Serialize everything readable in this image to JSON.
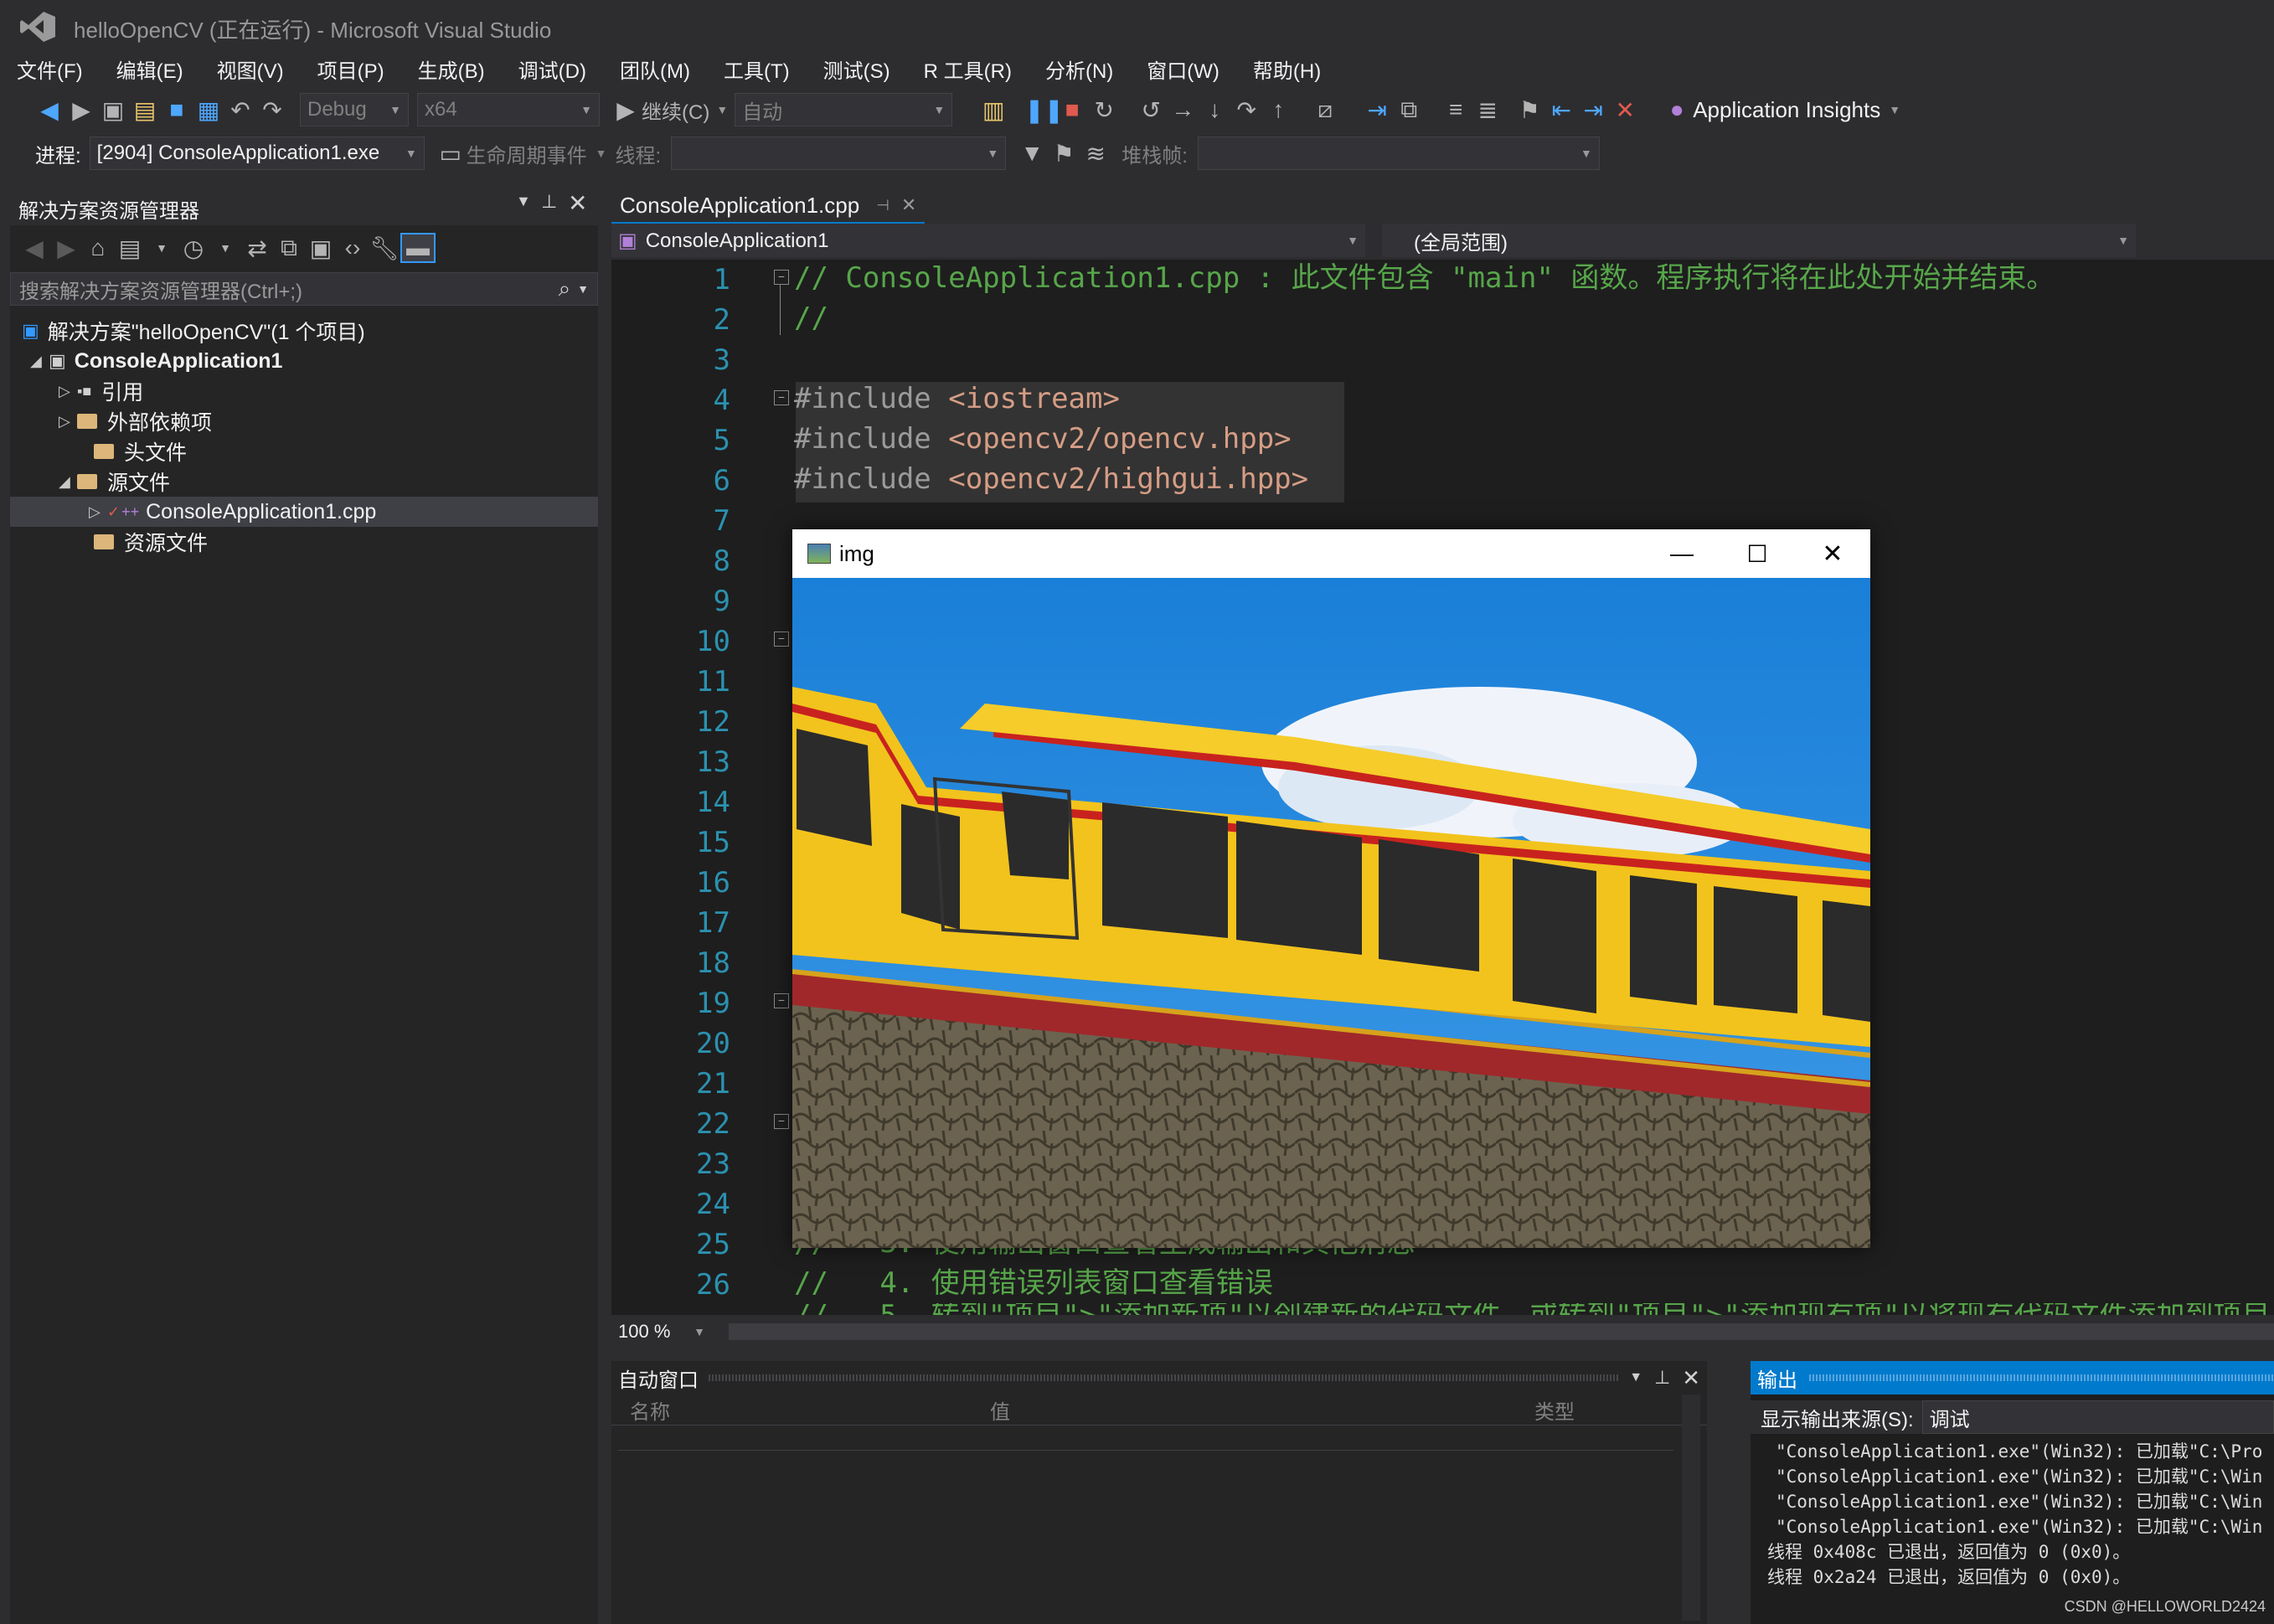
{
  "window": {
    "title": "helloOpenCV (正在运行) - Microsoft Visual Studio"
  },
  "menu": [
    "文件(F)",
    "编辑(E)",
    "视图(V)",
    "项目(P)",
    "生成(B)",
    "调试(D)",
    "团队(M)",
    "工具(T)",
    "测试(S)",
    "R 工具(R)",
    "分析(N)",
    "窗口(W)",
    "帮助(H)"
  ],
  "toolbar": {
    "config": "Debug",
    "platform": "x64",
    "continue_label": "继续(C)",
    "auto": "自动",
    "app_insights": "Application Insights"
  },
  "debug_toolbar": {
    "process_label": "进程:",
    "process_value": "[2904] ConsoleApplication1.exe",
    "lifecycle_label": "生命周期事件",
    "thread_label": "线程:",
    "stackframe_label": "堆栈帧:"
  },
  "solution_explorer": {
    "title": "解决方案资源管理器",
    "search_placeholder": "搜索解决方案资源管理器(Ctrl+;)",
    "solution": "解决方案\"helloOpenCV\"(1 个项目)",
    "project": "ConsoleApplication1",
    "items": [
      "引用",
      "外部依赖项",
      "头文件",
      "源文件",
      "ConsoleApplication1.cpp",
      "资源文件"
    ]
  },
  "editor": {
    "tab": "ConsoleApplication1.cpp",
    "nav_left": "ConsoleApplication1",
    "nav_right": "(全局范围)",
    "zoom": "100 %",
    "line_numbers": [
      "1",
      "2",
      "3",
      "4",
      "5",
      "6",
      "7",
      "8",
      "9",
      "10",
      "11",
      "12",
      "13",
      "14",
      "15",
      "16",
      "17",
      "18",
      "19",
      "20",
      "21",
      "22",
      "23",
      "24",
      "25",
      "26"
    ],
    "line1": "// ConsoleApplication1.cpp : 此文件包含 \"main\" 函数。程序执行将在此处开始并结束。",
    "line2": "//",
    "include_kw": "#include",
    "include1": "<iostream>",
    "include2": "<opencv2/opencv.hpp>",
    "include3": "<opencv2/highgui.hpp>",
    "line25": "//   3. 使用输出窗口查看生成输出和其他消息",
    "line26": "//   4. 使用错误列表窗口查看错误",
    "line27": "//   5. 转到\"项目\">\"添加新项\"以创建新的代码文件，或转到\"项目\">\"添加现有项\"以将现有代码文件添加到项目"
  },
  "img_window": {
    "title": "img"
  },
  "autos": {
    "title": "自动窗口",
    "columns": [
      "名称",
      "值",
      "类型"
    ]
  },
  "output": {
    "title": "输出",
    "source_label": "显示输出来源(S):",
    "source_value": "调试",
    "lines": [
      "\"ConsoleApplication1.exe\"(Win32): 已加载\"C:\\Pro",
      "\"ConsoleApplication1.exe\"(Win32): 已加载\"C:\\Win",
      "\"ConsoleApplication1.exe\"(Win32): 已加载\"C:\\Win",
      "\"ConsoleApplication1.exe\"(Win32): 已加载\"C:\\Win",
      "线程 0x408c 已退出，返回值为 0 (0x0)。",
      "线程 0x2a24 已退出，返回值为 0 (0x0)。"
    ]
  },
  "watermark": "CSDN @HELLOWORLD2424"
}
